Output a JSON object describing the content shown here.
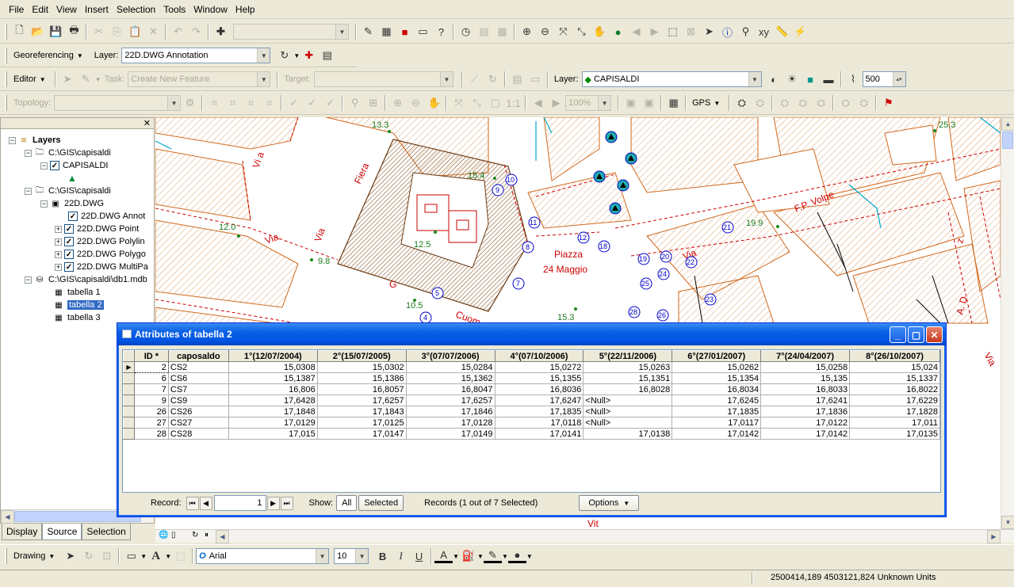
{
  "menu": [
    "File",
    "Edit",
    "View",
    "Insert",
    "Selection",
    "Tools",
    "Window",
    "Help"
  ],
  "georef": {
    "label": "Georeferencing",
    "layer_label": "Layer:",
    "layer_value": "22D.DWG Annotation"
  },
  "editor": {
    "label": "Editor",
    "task_label": "Task:",
    "task_value": "Create New Feature",
    "target_label": "Target:",
    "layer_label": "Layer:",
    "layer_value": "CAPISALDI",
    "scale_value": "500"
  },
  "topology": {
    "label": "Topology:",
    "zoom_value": "100%",
    "gps_label": "GPS"
  },
  "toc": {
    "root": "Layers",
    "items": [
      {
        "label": "C:\\GIS\\capisaldi"
      },
      {
        "label": "CAPISALDI"
      },
      {
        "label": "C:\\GIS\\capisaldi"
      },
      {
        "label": "22D.DWG"
      },
      {
        "label": "22D.DWG Annot"
      },
      {
        "label": "22D.DWG Point"
      },
      {
        "label": "22D.DWG Polylin"
      },
      {
        "label": "22D.DWG Polygo"
      },
      {
        "label": "22D.DWG MultiPa"
      },
      {
        "label": "C:\\GIS\\capisaldi\\db1.mdb"
      },
      {
        "label": "tabella 1"
      },
      {
        "label": "tabella 2"
      },
      {
        "label": "tabella 3"
      }
    ],
    "tabs": [
      "Display",
      "Source",
      "Selection"
    ]
  },
  "map": {
    "labels": [
      "13.3",
      "15.4",
      "25.3",
      "12.0",
      "12.5",
      "9.8",
      "10.5",
      "15.3",
      "19.9",
      "Piazza",
      "24 Maggio",
      "F.P. Volpe",
      "Via",
      "Via",
      "Fiera",
      "Cuom",
      "Vit",
      "Via",
      "A. D",
      "Vi a",
      "z",
      "Via",
      "G"
    ],
    "points": [
      "9",
      "10",
      "11",
      "12",
      "18",
      "19",
      "20",
      "21",
      "22",
      "23",
      "24",
      "25",
      "26",
      "28",
      "8",
      "7",
      "5",
      "4"
    ]
  },
  "dialog": {
    "title": "Attributes of tabella 2",
    "columns": [
      "ID *",
      "caposaldo",
      "1°(12/07/2004)",
      "2°(15/07/2005)",
      "3°(07/07/2006)",
      "4°(07/10/2006)",
      "5°(22/11/2006)",
      "6°(27/01/2007)",
      "7°(24/04/2007)",
      "8°(26/10/2007)"
    ],
    "rows": [
      [
        "2",
        "CS2",
        "15,0308",
        "15,0302",
        "15,0284",
        "15,0272",
        "15,0263",
        "15,0262",
        "15,0258",
        "15,024"
      ],
      [
        "6",
        "CS6",
        "15,1387",
        "15,1386",
        "15,1362",
        "15,1355",
        "15,1351",
        "15,1354",
        "15,135",
        "15,1337"
      ],
      [
        "7",
        "CS7",
        "16,806",
        "16,8057",
        "16,8047",
        "16,8036",
        "16,8028",
        "16,8034",
        "16,8033",
        "16,8022"
      ],
      [
        "9",
        "CS9",
        "17,6428",
        "17,6257",
        "17,6257",
        "17,6247",
        "<Null>",
        "17,6245",
        "17,6241",
        "17,6229"
      ],
      [
        "26",
        "CS26",
        "17,1848",
        "17,1843",
        "17,1846",
        "17,1835",
        "<Null>",
        "17,1835",
        "17,1836",
        "17,1828"
      ],
      [
        "27",
        "CS27",
        "17,0129",
        "17,0125",
        "17,0128",
        "17,0118",
        "<Null>",
        "17,0117",
        "17,0122",
        "17,011"
      ],
      [
        "28",
        "CS28",
        "17,015",
        "17,0147",
        "17,0149",
        "17,0141",
        "17,0138",
        "17,0142",
        "17,0142",
        "17,0135"
      ]
    ],
    "record_label": "Record:",
    "record_value": "1",
    "show_label": "Show:",
    "show_all": "All",
    "show_selected": "Selected",
    "records_status": "Records (1 out of 7 Selected)",
    "options_label": "Options"
  },
  "drawing": {
    "label": "Drawing",
    "font": "Arial",
    "size": "10",
    "bold": "B",
    "italic": "I",
    "underline": "U",
    "text_tool": "A"
  },
  "status": {
    "coords": "2500414,189  4503121,824 Unknown Units"
  },
  "colors": {
    "map_line": "#d2691e",
    "map_red": "#cc0000",
    "point_blue": "#0000cc",
    "title_blue": "#0054e3",
    "selection": "#316ac5"
  }
}
